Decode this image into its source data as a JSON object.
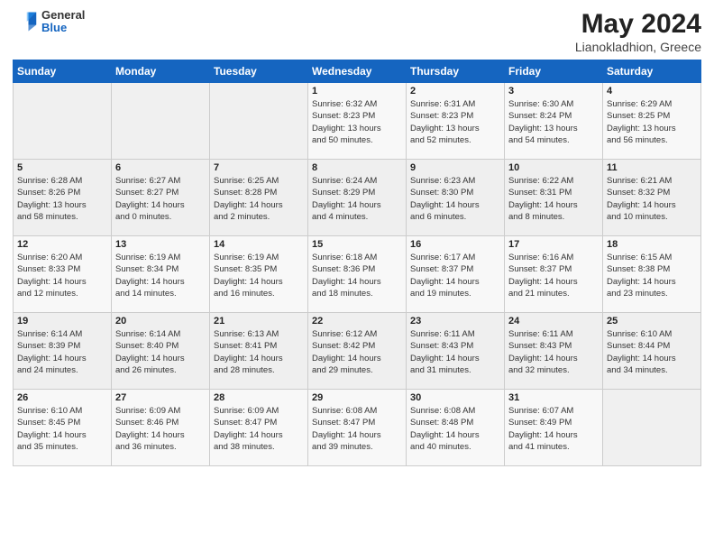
{
  "header": {
    "logo": {
      "general": "General",
      "blue": "Blue"
    },
    "title": "May 2024",
    "subtitle": "Lianokladhion, Greece"
  },
  "calendar": {
    "weekdays": [
      "Sunday",
      "Monday",
      "Tuesday",
      "Wednesday",
      "Thursday",
      "Friday",
      "Saturday"
    ],
    "weeks": [
      [
        {
          "day": "",
          "info": ""
        },
        {
          "day": "",
          "info": ""
        },
        {
          "day": "",
          "info": ""
        },
        {
          "day": "1",
          "info": "Sunrise: 6:32 AM\nSunset: 8:23 PM\nDaylight: 13 hours\nand 50 minutes."
        },
        {
          "day": "2",
          "info": "Sunrise: 6:31 AM\nSunset: 8:23 PM\nDaylight: 13 hours\nand 52 minutes."
        },
        {
          "day": "3",
          "info": "Sunrise: 6:30 AM\nSunset: 8:24 PM\nDaylight: 13 hours\nand 54 minutes."
        },
        {
          "day": "4",
          "info": "Sunrise: 6:29 AM\nSunset: 8:25 PM\nDaylight: 13 hours\nand 56 minutes."
        }
      ],
      [
        {
          "day": "5",
          "info": "Sunrise: 6:28 AM\nSunset: 8:26 PM\nDaylight: 13 hours\nand 58 minutes."
        },
        {
          "day": "6",
          "info": "Sunrise: 6:27 AM\nSunset: 8:27 PM\nDaylight: 14 hours\nand 0 minutes."
        },
        {
          "day": "7",
          "info": "Sunrise: 6:25 AM\nSunset: 8:28 PM\nDaylight: 14 hours\nand 2 minutes."
        },
        {
          "day": "8",
          "info": "Sunrise: 6:24 AM\nSunset: 8:29 PM\nDaylight: 14 hours\nand 4 minutes."
        },
        {
          "day": "9",
          "info": "Sunrise: 6:23 AM\nSunset: 8:30 PM\nDaylight: 14 hours\nand 6 minutes."
        },
        {
          "day": "10",
          "info": "Sunrise: 6:22 AM\nSunset: 8:31 PM\nDaylight: 14 hours\nand 8 minutes."
        },
        {
          "day": "11",
          "info": "Sunrise: 6:21 AM\nSunset: 8:32 PM\nDaylight: 14 hours\nand 10 minutes."
        }
      ],
      [
        {
          "day": "12",
          "info": "Sunrise: 6:20 AM\nSunset: 8:33 PM\nDaylight: 14 hours\nand 12 minutes."
        },
        {
          "day": "13",
          "info": "Sunrise: 6:19 AM\nSunset: 8:34 PM\nDaylight: 14 hours\nand 14 minutes."
        },
        {
          "day": "14",
          "info": "Sunrise: 6:19 AM\nSunset: 8:35 PM\nDaylight: 14 hours\nand 16 minutes."
        },
        {
          "day": "15",
          "info": "Sunrise: 6:18 AM\nSunset: 8:36 PM\nDaylight: 14 hours\nand 18 minutes."
        },
        {
          "day": "16",
          "info": "Sunrise: 6:17 AM\nSunset: 8:37 PM\nDaylight: 14 hours\nand 19 minutes."
        },
        {
          "day": "17",
          "info": "Sunrise: 6:16 AM\nSunset: 8:37 PM\nDaylight: 14 hours\nand 21 minutes."
        },
        {
          "day": "18",
          "info": "Sunrise: 6:15 AM\nSunset: 8:38 PM\nDaylight: 14 hours\nand 23 minutes."
        }
      ],
      [
        {
          "day": "19",
          "info": "Sunrise: 6:14 AM\nSunset: 8:39 PM\nDaylight: 14 hours\nand 24 minutes."
        },
        {
          "day": "20",
          "info": "Sunrise: 6:14 AM\nSunset: 8:40 PM\nDaylight: 14 hours\nand 26 minutes."
        },
        {
          "day": "21",
          "info": "Sunrise: 6:13 AM\nSunset: 8:41 PM\nDaylight: 14 hours\nand 28 minutes."
        },
        {
          "day": "22",
          "info": "Sunrise: 6:12 AM\nSunset: 8:42 PM\nDaylight: 14 hours\nand 29 minutes."
        },
        {
          "day": "23",
          "info": "Sunrise: 6:11 AM\nSunset: 8:43 PM\nDaylight: 14 hours\nand 31 minutes."
        },
        {
          "day": "24",
          "info": "Sunrise: 6:11 AM\nSunset: 8:43 PM\nDaylight: 14 hours\nand 32 minutes."
        },
        {
          "day": "25",
          "info": "Sunrise: 6:10 AM\nSunset: 8:44 PM\nDaylight: 14 hours\nand 34 minutes."
        }
      ],
      [
        {
          "day": "26",
          "info": "Sunrise: 6:10 AM\nSunset: 8:45 PM\nDaylight: 14 hours\nand 35 minutes."
        },
        {
          "day": "27",
          "info": "Sunrise: 6:09 AM\nSunset: 8:46 PM\nDaylight: 14 hours\nand 36 minutes."
        },
        {
          "day": "28",
          "info": "Sunrise: 6:09 AM\nSunset: 8:47 PM\nDaylight: 14 hours\nand 38 minutes."
        },
        {
          "day": "29",
          "info": "Sunrise: 6:08 AM\nSunset: 8:47 PM\nDaylight: 14 hours\nand 39 minutes."
        },
        {
          "day": "30",
          "info": "Sunrise: 6:08 AM\nSunset: 8:48 PM\nDaylight: 14 hours\nand 40 minutes."
        },
        {
          "day": "31",
          "info": "Sunrise: 6:07 AM\nSunset: 8:49 PM\nDaylight: 14 hours\nand 41 minutes."
        },
        {
          "day": "",
          "info": ""
        }
      ]
    ]
  }
}
